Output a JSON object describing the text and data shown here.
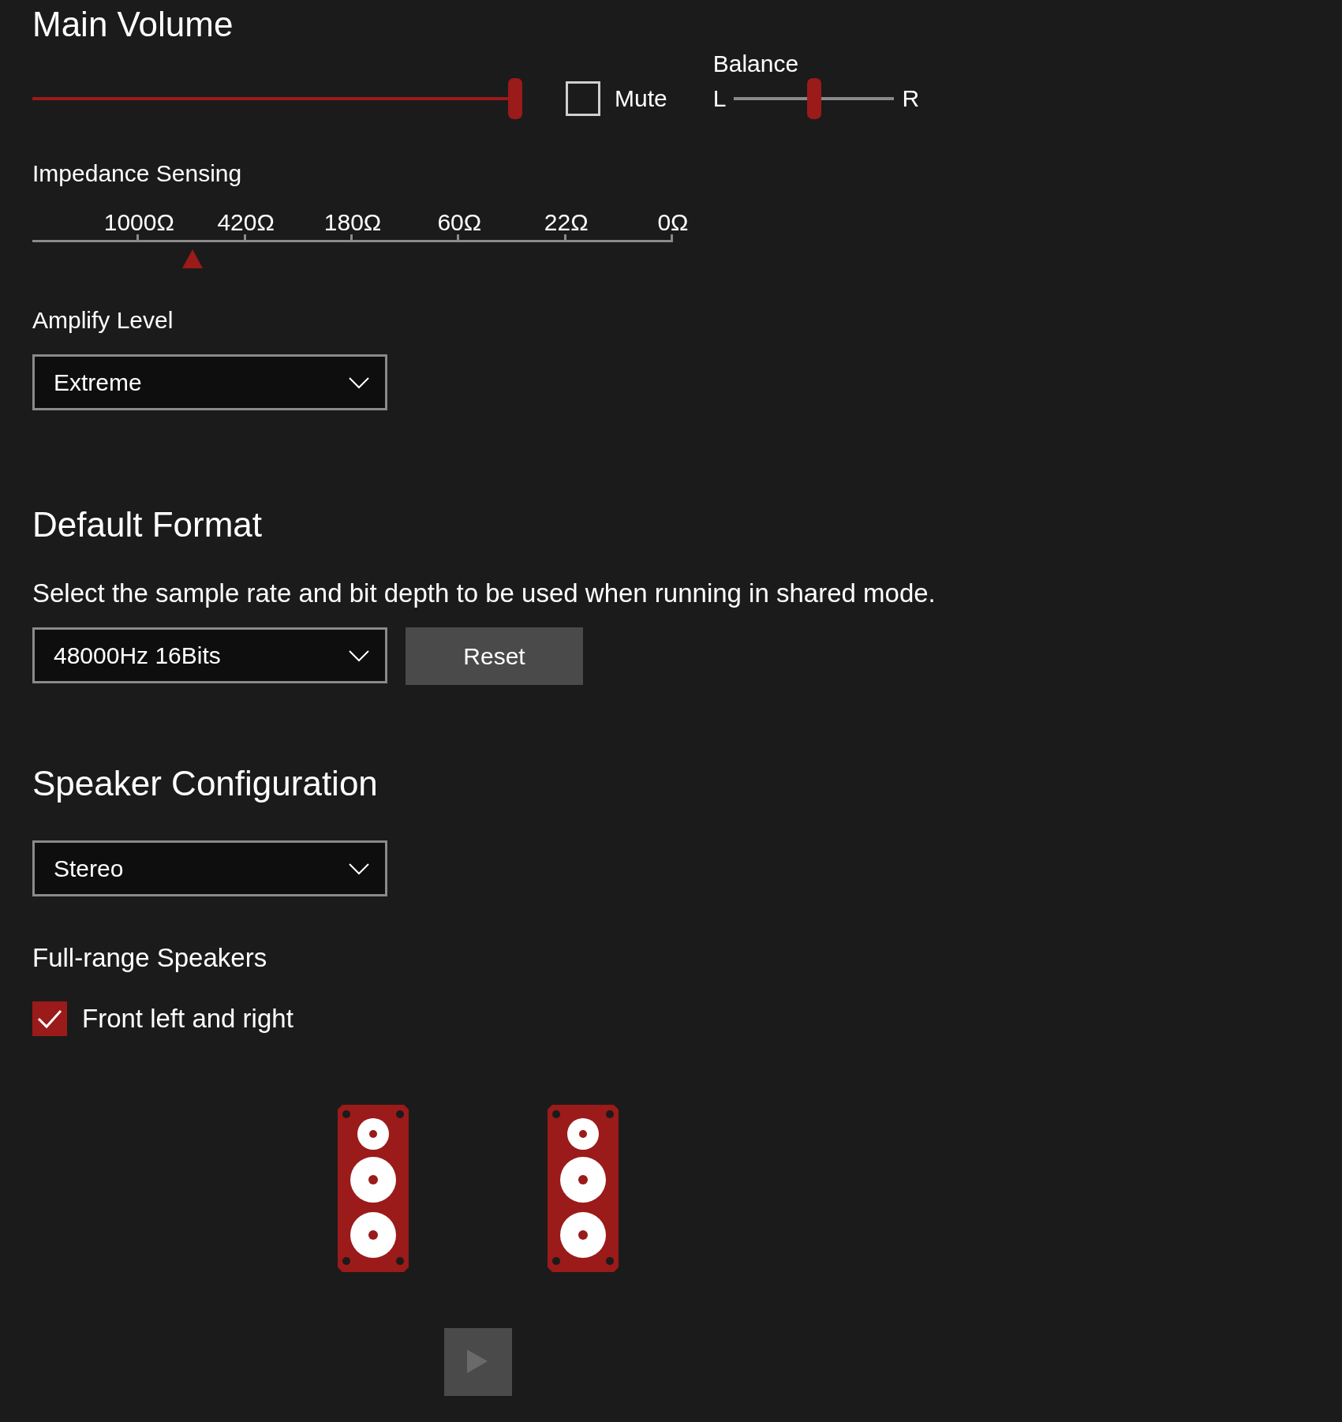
{
  "main_volume": {
    "title": "Main Volume",
    "level": 1.0,
    "mute": {
      "label": "Mute",
      "checked": false
    },
    "balance": {
      "label": "Balance",
      "left": "L",
      "right": "R",
      "level": 0.5
    }
  },
  "impedance_sensing": {
    "label": "Impedance Sensing",
    "ticks": [
      "1000Ω",
      "420Ω",
      "180Ω",
      "60Ω",
      "22Ω",
      "0Ω"
    ],
    "level": 0.25
  },
  "amplify_level": {
    "label": "Amplify Level",
    "value": "Extreme"
  },
  "default_format": {
    "title": "Default Format",
    "description": "Select the sample rate and bit depth to be used when running in shared mode.",
    "value": "48000Hz 16Bits",
    "reset": "Reset"
  },
  "speaker_configuration": {
    "title": "Speaker Configuration",
    "value": "Stereo",
    "full_range": {
      "label": "Full-range Speakers",
      "option": {
        "label": "Front left and right",
        "checked": true
      }
    },
    "speakers": [
      {
        "kind": "speaker"
      },
      {
        "kind": "speaker"
      }
    ],
    "test_button": {
      "disabled": true
    }
  }
}
